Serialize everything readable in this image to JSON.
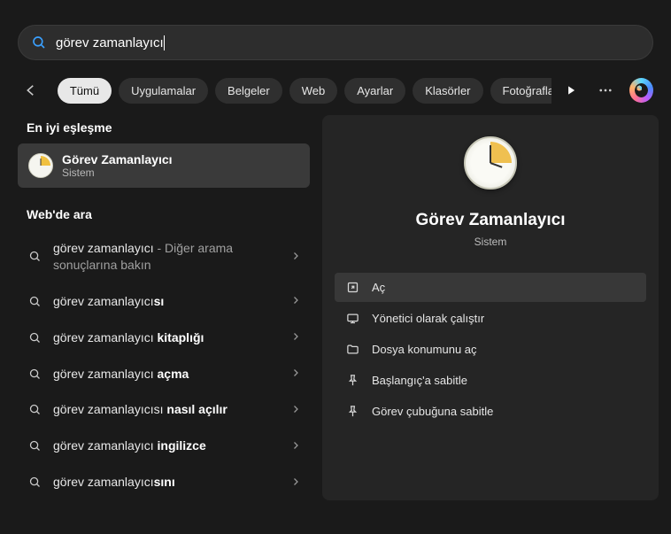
{
  "search": {
    "value": "görev zamanlayıcı"
  },
  "filters": {
    "items": [
      "Tümü",
      "Uygulamalar",
      "Belgeler",
      "Web",
      "Ayarlar",
      "Klasörler",
      "Fotoğraflar"
    ],
    "active_index": 0
  },
  "left": {
    "best_match_header": "En iyi eşleşme",
    "best_match": {
      "title": "Görev Zamanlayıcı",
      "subtitle": "Sistem"
    },
    "web_header": "Web'de ara",
    "web_items": [
      {
        "prefix": "görev zamanlayıcı",
        "bold": "",
        "suffix": " - Diğer arama sonuçlarına bakın"
      },
      {
        "prefix": "görev zamanlayıcı",
        "bold": "sı",
        "suffix": ""
      },
      {
        "prefix": "görev zamanlayıcı ",
        "bold": "kitaplığı",
        "suffix": ""
      },
      {
        "prefix": "görev zamanlayıcı ",
        "bold": "açma",
        "suffix": ""
      },
      {
        "prefix": "görev zamanlayıcısı ",
        "bold": "nasıl açılır",
        "suffix": ""
      },
      {
        "prefix": "görev zamanlayıcı ",
        "bold": "ingilizce",
        "suffix": ""
      },
      {
        "prefix": "görev zamanlayıcı",
        "bold": "sını",
        "suffix": ""
      }
    ]
  },
  "right": {
    "title": "Görev Zamanlayıcı",
    "subtitle": "Sistem",
    "actions": [
      {
        "icon": "open",
        "label": "Aç",
        "primary": true
      },
      {
        "icon": "admin",
        "label": "Yönetici olarak çalıştır",
        "primary": false
      },
      {
        "icon": "folder",
        "label": "Dosya konumunu aç",
        "primary": false
      },
      {
        "icon": "pin",
        "label": "Başlangıç'a sabitle",
        "primary": false
      },
      {
        "icon": "pin",
        "label": "Görev çubuğuna sabitle",
        "primary": false
      }
    ]
  }
}
